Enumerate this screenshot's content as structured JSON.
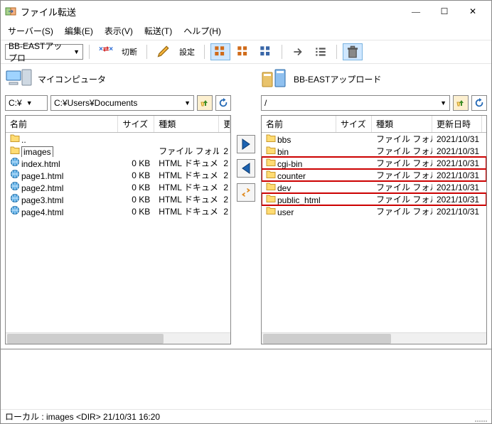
{
  "window_title": "ファイル転送",
  "menubar": [
    {
      "label": "サーバー(S)"
    },
    {
      "label": "編集(E)"
    },
    {
      "label": "表示(V)"
    },
    {
      "label": "転送(T)"
    },
    {
      "label": "ヘルプ(H)"
    }
  ],
  "toolbar": {
    "conn_label": "BB-EASTアップロ",
    "disconnect": "切断",
    "settings": "設定"
  },
  "local": {
    "title": "マイコンピュータ",
    "drive": "C:¥",
    "path": "C:¥Users¥Documents",
    "cols": {
      "name": "名前",
      "size": "サイズ",
      "type": "種類",
      "extra": "更"
    },
    "rows": [
      {
        "icon": "folder",
        "name": "..",
        "size": "",
        "type": ""
      },
      {
        "icon": "folder",
        "name": "images",
        "size": "",
        "type": "ファイル フォルダー",
        "extra": "2",
        "sel": true
      },
      {
        "icon": "html",
        "name": "index.html",
        "size": "0 KB",
        "type": "HTML ドキュメント",
        "extra": "2"
      },
      {
        "icon": "html",
        "name": "page1.html",
        "size": "0 KB",
        "type": "HTML ドキュメント",
        "extra": "2"
      },
      {
        "icon": "html",
        "name": "page2.html",
        "size": "0 KB",
        "type": "HTML ドキュメント",
        "extra": "2"
      },
      {
        "icon": "html",
        "name": "page3.html",
        "size": "0 KB",
        "type": "HTML ドキュメント",
        "extra": "2"
      },
      {
        "icon": "html",
        "name": "page4.html",
        "size": "0 KB",
        "type": "HTML ドキュメント",
        "extra": "2"
      }
    ]
  },
  "remote": {
    "title": "BB-EASTアップロード",
    "path": "/",
    "cols": {
      "name": "名前",
      "size": "サイズ",
      "type": "種類",
      "date": "更新日時"
    },
    "rows": [
      {
        "icon": "folder",
        "name": "bbs",
        "size": "",
        "type": "ファイル フォルダー",
        "date": "2021/10/31"
      },
      {
        "icon": "folder",
        "name": "bin",
        "size": "",
        "type": "ファイル フォルダー",
        "date": "2021/10/31"
      },
      {
        "icon": "folder",
        "name": "cgi-bin",
        "size": "",
        "type": "ファイル フォルダー",
        "date": "2021/10/31",
        "hl": true
      },
      {
        "icon": "folder",
        "name": "counter",
        "size": "",
        "type": "ファイル フォルダー",
        "date": "2021/10/31",
        "hl": true
      },
      {
        "icon": "folder",
        "name": "dev",
        "size": "",
        "type": "ファイル フォルダー",
        "date": "2021/10/31"
      },
      {
        "icon": "folder",
        "name": "public_html",
        "size": "",
        "type": "ファイル フォルダー",
        "date": "2021/10/31",
        "hl": true
      },
      {
        "icon": "folder",
        "name": "user",
        "size": "",
        "type": "ファイル フォルダー",
        "date": "2021/10/31"
      }
    ]
  },
  "status": "ローカル : images <DIR> 21/10/31 16:20"
}
